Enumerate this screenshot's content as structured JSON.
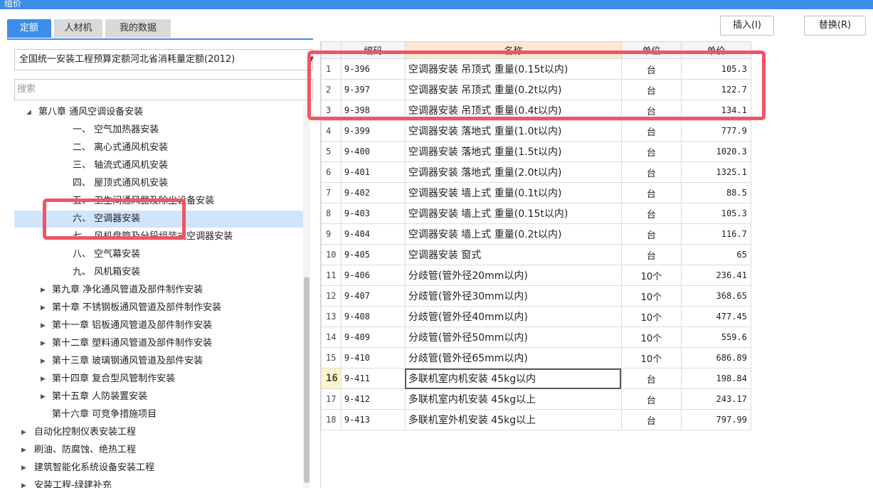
{
  "window": {
    "title": "组价"
  },
  "tabs": [
    {
      "label": "定额"
    },
    {
      "label": "人材机"
    },
    {
      "label": "我的数据"
    }
  ],
  "toolbar": {
    "insert_label": "插入(I)",
    "replace_label": "替换(R)"
  },
  "library_select": {
    "value": "全国统一安装工程预算定额河北省消耗量定额(2012)"
  },
  "search": {
    "placeholder": "搜索"
  },
  "tree": [
    {
      "label": "第八章 通风空调设备安装",
      "expanded": true
    },
    {
      "label": "一、 空气加热器安装"
    },
    {
      "label": "二、 离心式通风机安装"
    },
    {
      "label": "三、 轴流式通风机安装"
    },
    {
      "label": "四、 屋顶式通风机安装"
    },
    {
      "label": "五、 卫生间通风器及除尘设备安装"
    },
    {
      "label": "六、 空调器安装",
      "selected": true
    },
    {
      "label": "七、 风机盘管及分段组装式空调器安装"
    },
    {
      "label": "八、 空气幕安装"
    },
    {
      "label": "九、 风机箱安装"
    },
    {
      "label": "第九章 净化通风管道及部件制作安装"
    },
    {
      "label": "第十章 不锈钢板通风管道及部件制作安装"
    },
    {
      "label": "第十一章 铝板通风管道及部件制作安装"
    },
    {
      "label": "第十二章 塑料通风管道及部件制作安装"
    },
    {
      "label": "第十三章 玻璃钢通风管道及部件安装"
    },
    {
      "label": "第十四章 复合型风管制作安装"
    },
    {
      "label": "第十五章 人防装置安装"
    },
    {
      "label": "第十六章 可竞争措施项目"
    },
    {
      "label": "自动化控制仪表安装工程"
    },
    {
      "label": "刷油、防腐蚀、绝热工程"
    },
    {
      "label": "建筑智能化系统设备安装工程"
    },
    {
      "label": "安装工程-绿建补充"
    }
  ],
  "table": {
    "columns": [
      "编码",
      "名称",
      "单位",
      "单价"
    ],
    "current_row": 16,
    "rows": [
      {
        "idx": "1",
        "code": "9-396",
        "name": "空调器安装 吊顶式 重量(0.15t以内)",
        "unit": "台",
        "price": "105.3"
      },
      {
        "idx": "2",
        "code": "9-397",
        "name": "空调器安装 吊顶式 重量(0.2t以内)",
        "unit": "台",
        "price": "122.7"
      },
      {
        "idx": "3",
        "code": "9-398",
        "name": "空调器安装 吊顶式 重量(0.4t以内)",
        "unit": "台",
        "price": "134.1"
      },
      {
        "idx": "4",
        "code": "9-399",
        "name": "空调器安装 落地式 重量(1.0t以内)",
        "unit": "台",
        "price": "777.9"
      },
      {
        "idx": "5",
        "code": "9-400",
        "name": "空调器安装 落地式 重量(1.5t以内)",
        "unit": "台",
        "price": "1020.3"
      },
      {
        "idx": "6",
        "code": "9-401",
        "name": "空调器安装 落地式 重量(2.0t以内)",
        "unit": "台",
        "price": "1325.1"
      },
      {
        "idx": "7",
        "code": "9-402",
        "name": "空调器安装 墙上式 重量(0.1t以内)",
        "unit": "台",
        "price": "88.5"
      },
      {
        "idx": "8",
        "code": "9-403",
        "name": "空调器安装 墙上式 重量(0.15t以内)",
        "unit": "台",
        "price": "105.3"
      },
      {
        "idx": "9",
        "code": "9-404",
        "name": "空调器安装 墙上式 重量(0.2t以内)",
        "unit": "台",
        "price": "116.7"
      },
      {
        "idx": "10",
        "code": "9-405",
        "name": "空调器安装 窗式",
        "unit": "台",
        "price": "65"
      },
      {
        "idx": "11",
        "code": "9-406",
        "name": "分歧管(管外径20mm以内)",
        "unit": "10个",
        "price": "236.41"
      },
      {
        "idx": "12",
        "code": "9-407",
        "name": "分歧管(管外径30mm以内)",
        "unit": "10个",
        "price": "368.65"
      },
      {
        "idx": "13",
        "code": "9-408",
        "name": "分歧管(管外径40mm以内)",
        "unit": "10个",
        "price": "477.45"
      },
      {
        "idx": "14",
        "code": "9-409",
        "name": "分歧管(管外径50mm以内)",
        "unit": "10个",
        "price": "559.6"
      },
      {
        "idx": "15",
        "code": "9-410",
        "name": "分歧管(管外径65mm以内)",
        "unit": "10个",
        "price": "686.89"
      },
      {
        "idx": "16",
        "code": "9-411",
        "name": "多联机室内机安装 45kg以内",
        "unit": "台",
        "price": "198.84"
      },
      {
        "idx": "17",
        "code": "9-412",
        "name": "多联机室内机安装 45kg以上",
        "unit": "台",
        "price": "243.17"
      },
      {
        "idx": "18",
        "code": "9-413",
        "name": "多联机室外机安装 45kg以上",
        "unit": "台",
        "price": "797.99"
      }
    ]
  },
  "colors": {
    "accent": "#3d8ee8",
    "highlight": "#f05566",
    "selected_bg": "#cfe5fb"
  }
}
